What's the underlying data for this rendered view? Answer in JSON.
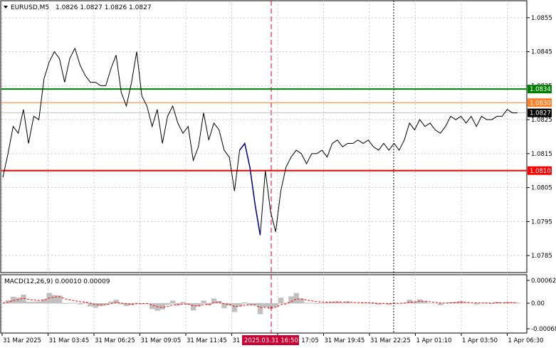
{
  "header": {
    "symbol": "EURUSD,M5",
    "ohlc": "1.0826 1.0827 1.0826 1.0827",
    "menu_icon": "triangle-down-icon"
  },
  "macd": {
    "label": "MACD(12,26,9) 0.00010 0.00009",
    "axis": [
      "0.00062",
      "0.00",
      "-0.00068"
    ],
    "hist_color": "#c0c0c0",
    "signal_color": "#ff0000"
  },
  "price_axis": [
    "1.0855",
    "1.0845",
    "1.0835",
    "1.0825",
    "1.0815",
    "1.0805",
    "1.0795",
    "1.0785"
  ],
  "levels": [
    {
      "price": "1.0834",
      "color": "#008000",
      "text_color": "#ffffff"
    },
    {
      "price": "1.0830",
      "color": "#ff7f27",
      "text_color": "#ffffff"
    },
    {
      "price": "1.0810",
      "color": "#ff0000",
      "text_color": "#ffffff"
    }
  ],
  "current_price": {
    "price": "1.0827",
    "bg": "#000000",
    "text_color": "#ffffff"
  },
  "time_axis": [
    "31 Mar 2025",
    "31 Mar 03:45",
    "31 Mar 06:25",
    "31 Mar 09:05",
    "31 Mar 11:45",
    "31 Mar 14:",
    "31 Mar 17:05",
    "31 Mar 19:45",
    "31 Mar 22:25",
    "1 Apr 01:10",
    "1 Apr 03:50",
    "1 Apr 06:30"
  ],
  "time_marker": {
    "label": "2025.03.31 16:50",
    "bg": "#cc0033",
    "text_color": "#ffffff"
  },
  "colors": {
    "price_line": "#000000",
    "highlight": "#00008b",
    "grid": "#c8c8c8",
    "cursor": "#cc0033"
  },
  "chart_data": {
    "type": "line",
    "series": [
      {
        "x_index": [
          0,
          2,
          4,
          6,
          8,
          10,
          12,
          14,
          16,
          18,
          20,
          22,
          24,
          26,
          28,
          30,
          32,
          34,
          36,
          38,
          40,
          42,
          44,
          46,
          48,
          50,
          52,
          54,
          56,
          58,
          60,
          62,
          64,
          66,
          68,
          70,
          72,
          74,
          76,
          78,
          80,
          82,
          84,
          86,
          88,
          90,
          92,
          94,
          96,
          98,
          100,
          102,
          104,
          106,
          108,
          110,
          112,
          114,
          116,
          118,
          120,
          122,
          124,
          126,
          128,
          130,
          132,
          134,
          136,
          138,
          140,
          142,
          144,
          146,
          148,
          150,
          152,
          154,
          156,
          158,
          160,
          162,
          164,
          166,
          168,
          170,
          172,
          174,
          176,
          178,
          180,
          182,
          184,
          186,
          188,
          190,
          192,
          194,
          196,
          198,
          200
        ],
        "values": [
          1.0808,
          1.0815,
          1.0823,
          1.0821,
          1.0828,
          1.0818,
          1.0826,
          1.0825,
          1.0837,
          1.0842,
          1.0845,
          1.0843,
          1.0836,
          1.0843,
          1.0846,
          1.0841,
          1.0838,
          1.0836,
          1.0836,
          1.0835,
          1.0835,
          1.084,
          1.0844,
          1.0833,
          1.0829,
          1.0836,
          1.0845,
          1.0832,
          1.0829,
          1.0823,
          1.0828,
          1.0818,
          1.0826,
          1.0829,
          1.0824,
          1.0821,
          1.0823,
          1.0813,
          1.0817,
          1.0827,
          1.0819,
          1.0824,
          1.0822,
          1.0816,
          1.0814,
          1.0804,
          1.0816,
          1.0818,
          1.0811,
          1.08,
          1.0791,
          1.081,
          1.0798,
          1.0792,
          1.0804,
          1.0811,
          1.0814,
          1.0816,
          1.0815,
          1.0812,
          1.0815,
          1.0815,
          1.0816,
          1.0814,
          1.0818,
          1.0819,
          1.0817,
          1.0818,
          1.0818,
          1.0819,
          1.0818,
          1.0819,
          1.0817,
          1.0816,
          1.0818,
          1.0816,
          1.0818,
          1.0816,
          1.0819,
          1.0824,
          1.0822,
          1.0825,
          1.0823,
          1.0824,
          1.0822,
          1.0821,
          1.0823,
          1.0826,
          1.0825,
          1.0826,
          1.0824,
          1.0826,
          1.0823,
          1.0826,
          1.0825,
          1.0825,
          1.0826,
          1.0826,
          1.0828,
          1.0827,
          1.0827
        ]
      }
    ],
    "ylim": [
      1.078,
      1.086
    ]
  }
}
